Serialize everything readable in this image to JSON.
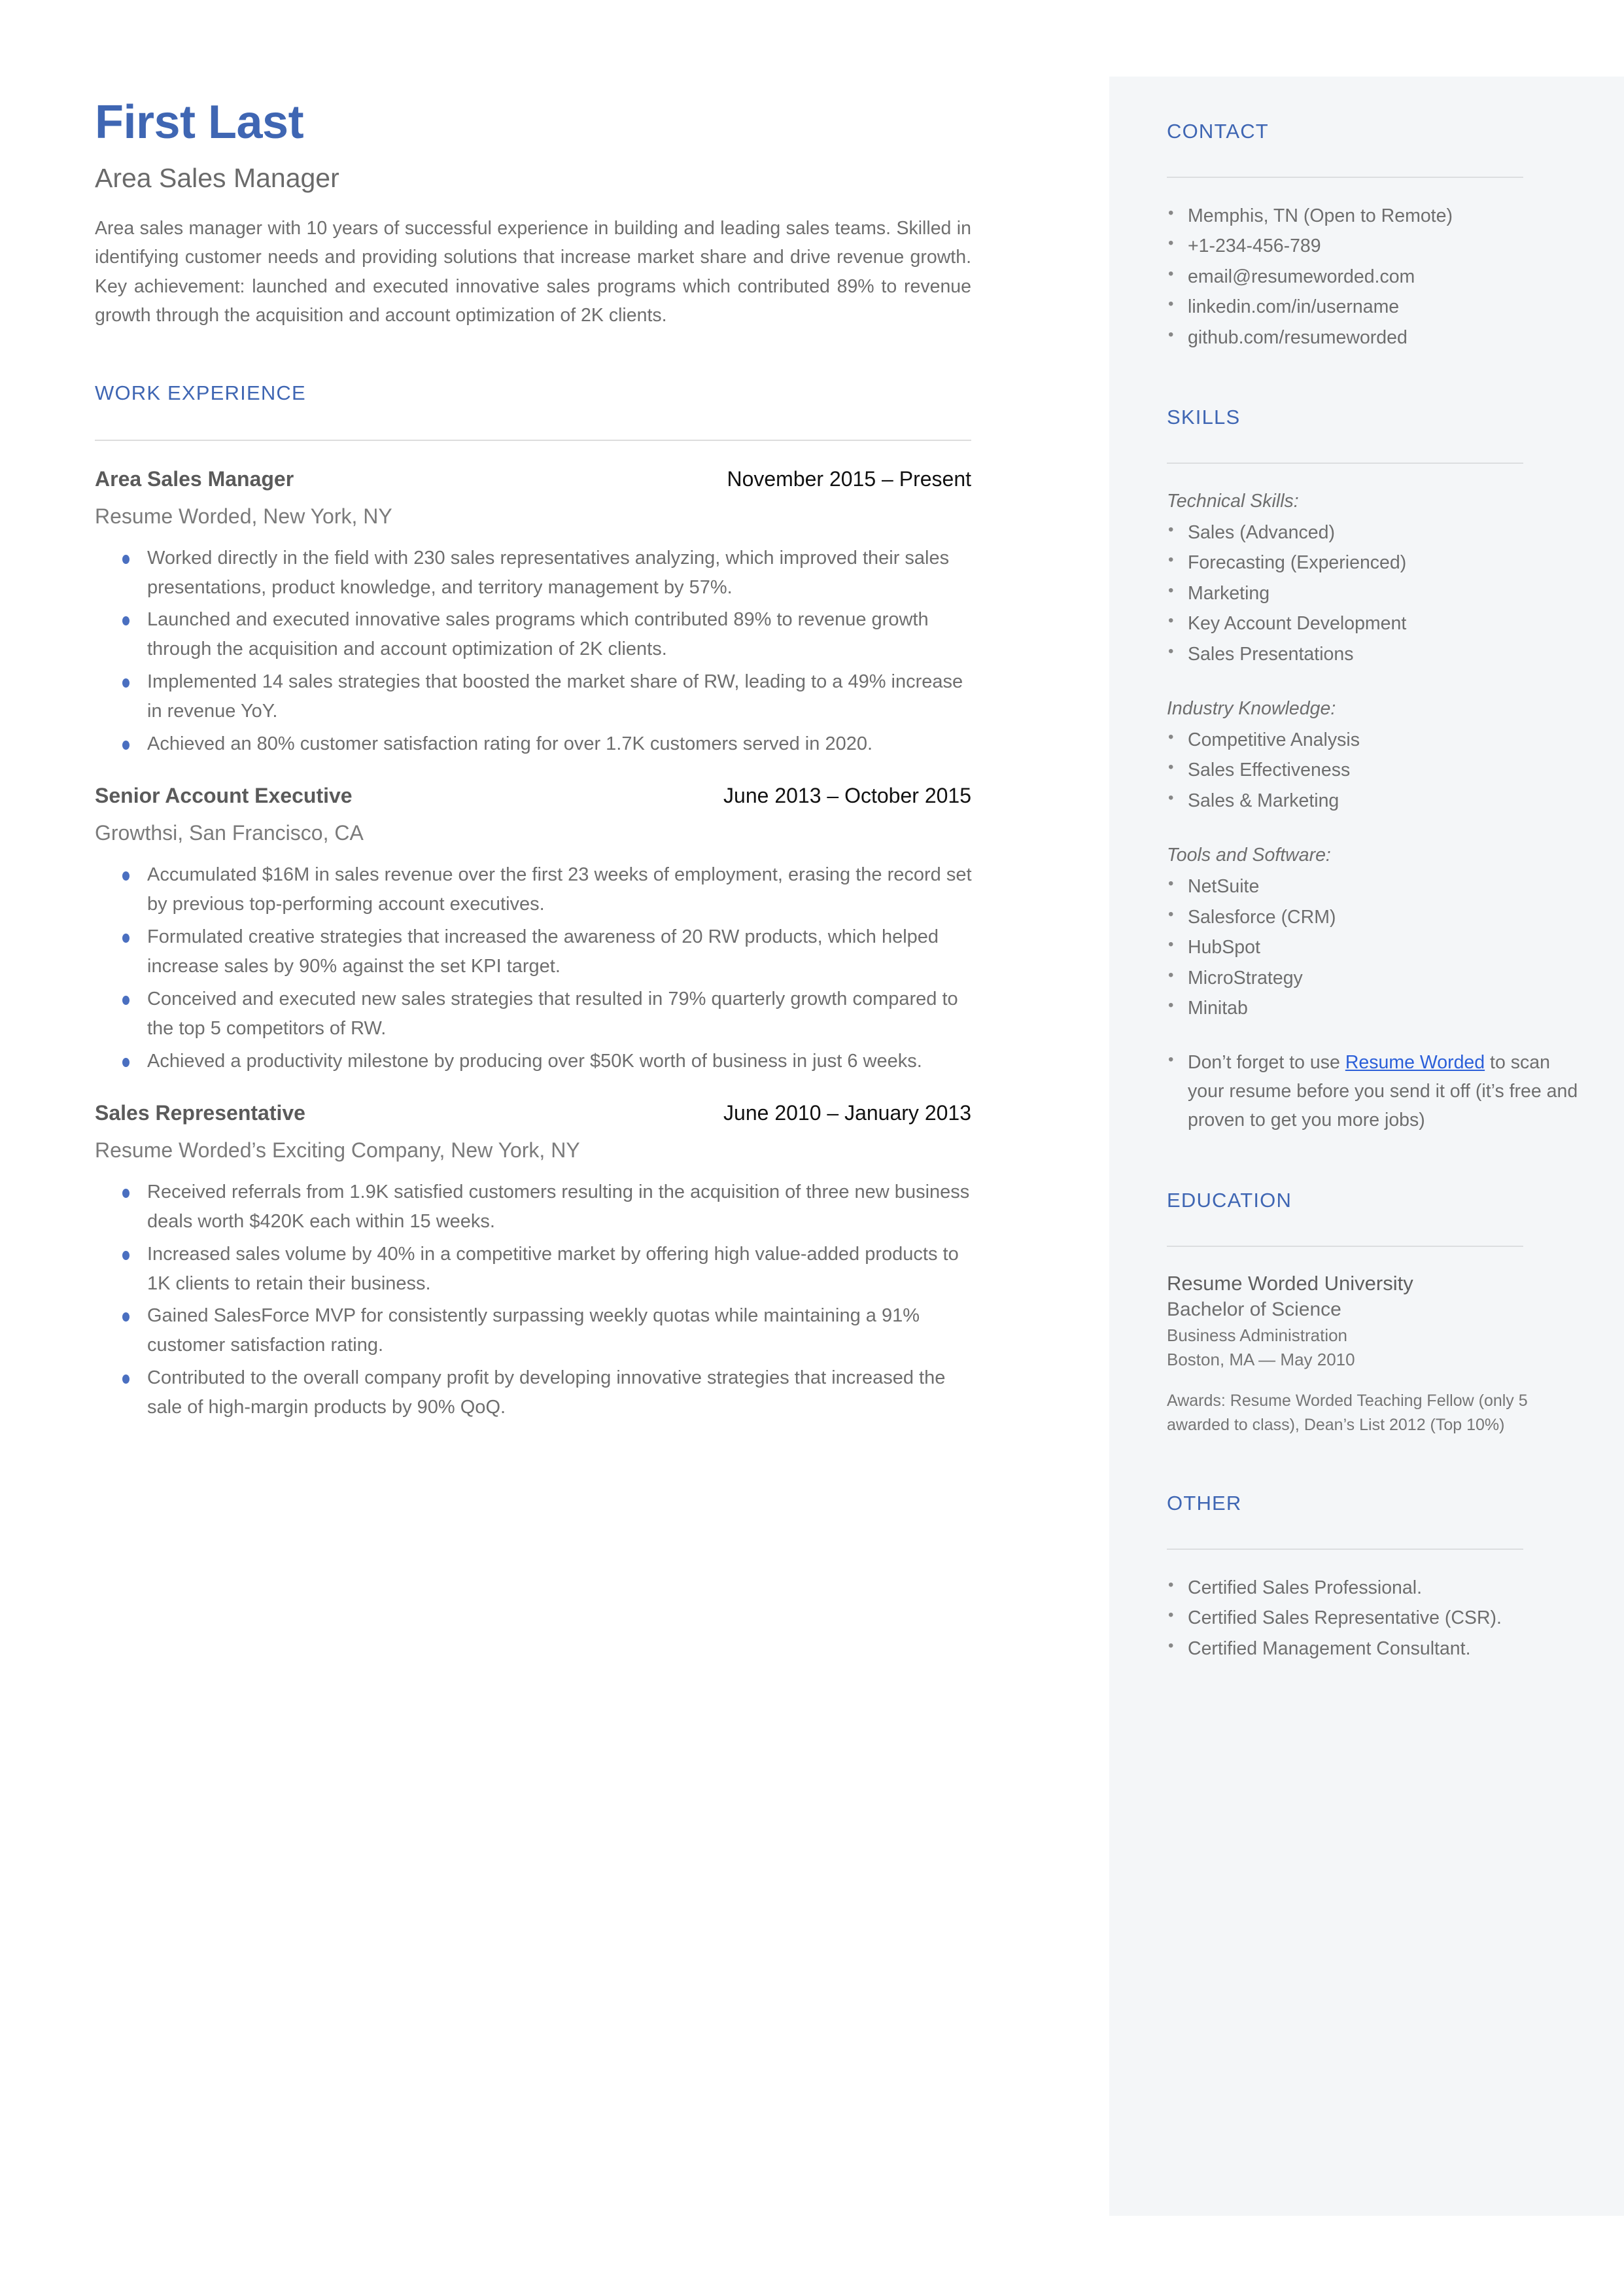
{
  "theme": {
    "accent_blue": "#3f66b3",
    "bullet_blue": "#4a6fc0",
    "link_blue": "#2b5fd9",
    "body_gray": "#6e6e6e",
    "sidebar_bg": "#f4f6f8"
  },
  "header": {
    "full_name": "First Last",
    "headline": "Area Sales Manager",
    "summary": "Area sales manager with 10 years of successful experience in building and leading sales teams. Skilled in identifying customer needs and providing solutions that increase market share and drive revenue growth. Key achievement: launched and executed innovative sales programs which contributed 89% to revenue growth through the acquisition and account optimization of 2K clients."
  },
  "work_experience": {
    "section_title": "WORK EXPERIENCE",
    "jobs": [
      {
        "title": "Area Sales Manager",
        "dates": "November 2015 – Present",
        "company": "Resume Worded, New York, NY",
        "bullets": [
          "Worked directly in the field with 230 sales representatives analyzing, which improved their sales presentations, product knowledge, and territory management by 57%.",
          "Launched and executed innovative sales programs which contributed 89% to revenue growth through the acquisition and account optimization of 2K clients.",
          "Implemented 14 sales strategies that boosted the market share of RW, leading to a 49% increase in revenue YoY.",
          "Achieved an 80% customer satisfaction rating for over 1.7K customers served in 2020."
        ]
      },
      {
        "title": "Senior Account Executive",
        "dates": "June 2013 – October 2015",
        "company": "Growthsi, San Francisco, CA",
        "bullets": [
          "Accumulated $16M in sales revenue over the first 23 weeks of employment, erasing the record set by previous top-performing account executives.",
          "Formulated creative strategies that increased the awareness of 20 RW products, which helped increase sales by 90% against the set KPI target.",
          "Conceived and executed new sales strategies that resulted in 79% quarterly growth compared to the top 5 competitors of RW.",
          "Achieved a productivity milestone by producing over $50K worth of business in just 6 weeks."
        ]
      },
      {
        "title": "Sales Representative",
        "dates": "June 2010 – January 2013",
        "company": "Resume Worded’s Exciting Company, New York, NY",
        "bullets": [
          "Received referrals from 1.9K satisfied customers resulting in the acquisition of three new business deals worth $420K each within 15 weeks.",
          "Increased sales volume by 40% in a competitive market by offering high value-added products to 1K clients to retain their business.",
          "Gained SalesForce MVP for consistently surpassing weekly quotas while maintaining a 91% customer satisfaction rating.",
          "Contributed to the overall company profit by developing innovative strategies that increased the sale of high-margin products by 90% QoQ."
        ]
      }
    ]
  },
  "sidebar": {
    "contact": {
      "section_title": "CONTACT",
      "items": [
        "Memphis, TN (Open to Remote)",
        "+1-234-456-789",
        "email@resumeworded.com",
        "linkedin.com/in/username",
        "github.com/resumeworded"
      ]
    },
    "skills": {
      "section_title": "SKILLS",
      "groups": [
        {
          "label": "Technical Skills:",
          "items": [
            "Sales (Advanced)",
            "Forecasting (Experienced)",
            "Marketing",
            "Key Account Development",
            "Sales Presentations"
          ]
        },
        {
          "label": "Industry Knowledge:",
          "items": [
            "Competitive Analysis",
            "Sales Effectiveness",
            "Sales & Marketing"
          ]
        },
        {
          "label": "Tools and Software:",
          "items": [
            "NetSuite",
            "Salesforce (CRM)",
            "HubSpot",
            "MicroStrategy",
            "Minitab"
          ]
        }
      ],
      "promo": {
        "before_link": "Don’t forget to use ",
        "link_text": "Resume Worded",
        "after_link": " to scan your resume before you send it off (it’s free and proven to get you more jobs)"
      }
    },
    "education": {
      "section_title": "EDUCATION",
      "school": "Resume Worded University",
      "degree": "Bachelor of Science",
      "field": "Business Administration",
      "location_date": "Boston, MA — May 2010",
      "awards": "Awards: Resume Worded Teaching Fellow (only 5 awarded to class), Dean’s List 2012 (Top 10%)"
    },
    "other": {
      "section_title": "OTHER",
      "items": [
        "Certified Sales Professional.",
        "Certified Sales Representative (CSR).",
        "Certified Management Consultant."
      ]
    }
  }
}
